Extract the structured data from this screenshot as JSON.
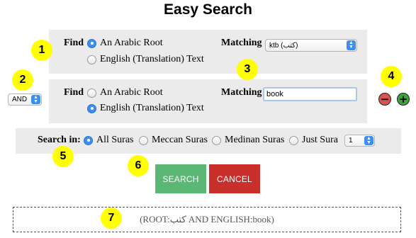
{
  "title": "Easy Search",
  "row1": {
    "find_label": "Find",
    "option_root": "An Arabic Root",
    "option_english": "English (Translation) Text",
    "selected": "root",
    "matching_label": "Matching",
    "matching_value": "ktb (كتب)"
  },
  "row2": {
    "operator_value": "AND",
    "find_label": "Find",
    "option_root": "An Arabic Root",
    "option_english": "English (Translation) Text",
    "selected": "english",
    "matching_label": "Matching",
    "matching_value": "book",
    "remove_icon": "minus-icon",
    "add_icon": "plus-icon"
  },
  "search_in": {
    "label": "Search in:",
    "options": [
      "All Suras",
      "Meccan Suras",
      "Medinan Suras",
      "Just Sura"
    ],
    "selected": "All Suras",
    "sura_value": "1"
  },
  "buttons": {
    "search_label": "SEARCH",
    "cancel_label": "CANCEL",
    "search_color": "#5bb774",
    "cancel_color": "#c9302c"
  },
  "query_text": "(ROOT:كتب AND ENGLISH:book)",
  "badges": [
    "1",
    "2",
    "3",
    "4",
    "5",
    "6",
    "7"
  ],
  "colors": {
    "badge": "#ffff00",
    "accent": "#3d8ef0",
    "remove": "#d9534f",
    "add": "#3aa63a"
  }
}
